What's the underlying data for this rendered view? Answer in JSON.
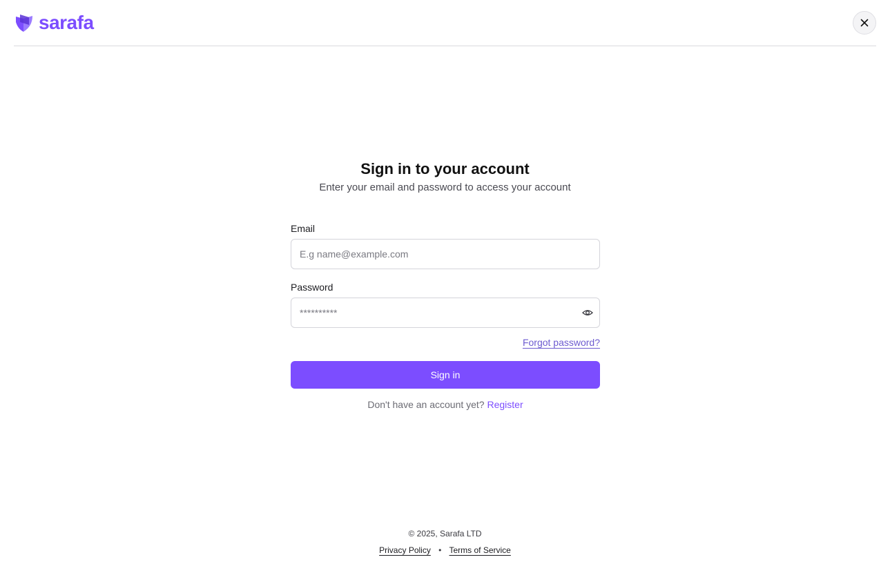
{
  "brand": {
    "name": "sarafa",
    "color": "#7c4dff"
  },
  "header": {
    "close_icon": "close-icon"
  },
  "main": {
    "title": "Sign in to your account",
    "subtitle": "Enter your email and password to access your account"
  },
  "form": {
    "email_label": "Email",
    "email_placeholder": "E.g name@example.com",
    "password_label": "Password",
    "password_placeholder": "**********",
    "password_toggle_icon": "eye-icon",
    "forgot_label": "Forgot password?",
    "submit_label": "Sign in",
    "register_prompt": "Don't have an account yet?",
    "register_label": "Register"
  },
  "footer": {
    "copyright": "© 2025, Sarafa LTD",
    "privacy_label": "Privacy Policy",
    "separator": "•",
    "terms_label": "Terms of Service"
  }
}
